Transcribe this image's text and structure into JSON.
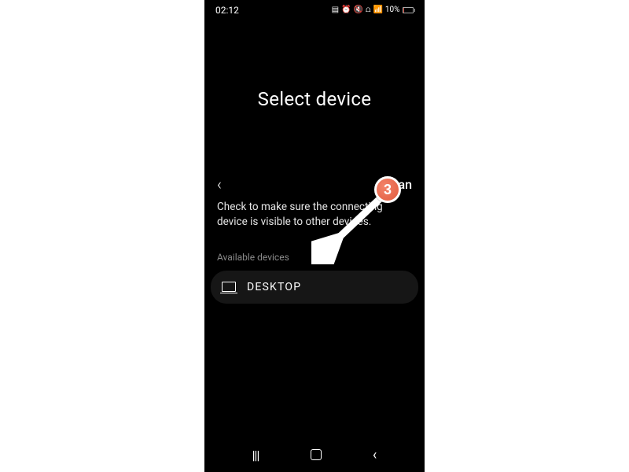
{
  "status": {
    "time": "02:12",
    "battery_pct": "10%"
  },
  "page": {
    "title": "Select device",
    "scan_label": "Scan",
    "instruction": "Check to make sure the connecting device is visible to other devices.",
    "available_label": "Available devices"
  },
  "devices": [
    {
      "name": "DESKTOP"
    }
  ],
  "annotation": {
    "step": "3"
  }
}
